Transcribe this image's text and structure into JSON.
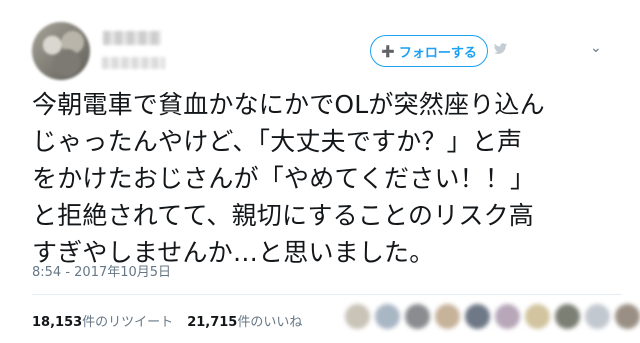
{
  "header": {
    "follow_label": "フォローする",
    "follow_icon": "add-user-icon"
  },
  "tweet": {
    "text": "今朝電車で貧血かなにかでOLが突然座り込ん\nじゃったんやけど、「大丈夫ですか？」と声\nをかけたおじさんが「やめてください！！」\nと拒絶されてて、親切にすることのリスク高\nすぎやしませんか…と思いました。",
    "timestamp": "8:54 - 2017年10月5日"
  },
  "stats": {
    "retweets_count": "18,153",
    "retweets_label": "件のリツイート",
    "likes_count": "21,715",
    "likes_label": "件のいいね"
  },
  "colors": {
    "accent": "#1da1f2",
    "muted": "#657786",
    "text": "#14171a"
  },
  "likers": [
    "#c9c3b8",
    "#a9b6c4",
    "#8a8c8f",
    "#c7b29a",
    "#6e7886",
    "#b7a7b9",
    "#d1c49f",
    "#7b7f74",
    "#c2c8cf",
    "#9a8f84"
  ]
}
